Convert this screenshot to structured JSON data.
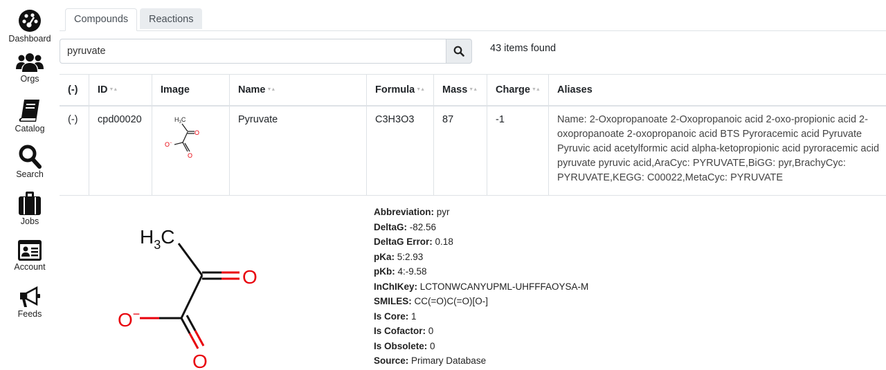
{
  "sidebar": {
    "items": [
      {
        "label": "Dashboard",
        "icon": "dashboard-icon"
      },
      {
        "label": "Orgs",
        "icon": "users-icon"
      },
      {
        "label": "Catalog",
        "icon": "book-icon"
      },
      {
        "label": "Search",
        "icon": "search-icon"
      },
      {
        "label": "Jobs",
        "icon": "briefcase-icon"
      },
      {
        "label": "Account",
        "icon": "id-card-icon"
      },
      {
        "label": "Feeds",
        "icon": "megaphone-icon"
      }
    ]
  },
  "tabs": [
    {
      "label": "Compounds",
      "active": true
    },
    {
      "label": "Reactions",
      "active": false
    }
  ],
  "search": {
    "value": "pyruvate",
    "icon": "search-icon",
    "results_text": "43 items found"
  },
  "table": {
    "columns": [
      "(-)",
      "ID",
      "Image",
      "Name",
      "Formula",
      "Mass",
      "Charge",
      "Aliases"
    ],
    "rows": [
      {
        "toggle": "(-)",
        "id": "cpd00020",
        "name": "Pyruvate",
        "formula": "C3H3O3",
        "mass": "87",
        "charge": "-1",
        "aliases": "Name: 2-Oxopropanoate 2-Oxopropanoic acid 2-oxo-propionic acid 2-oxopropanoate 2-oxopropanoic acid BTS Pyroracemic acid Pyruvate Pyruvic acid acetylformic acid alpha-ketopropionic acid pyroracemic acid pyruvate pyruvic acid,AraCyc: PYRUVATE,BiGG: pyr,BrachyCyc: PYRUVATE,KEGG: C00022,MetaCyc: PYRUVATE"
      }
    ]
  },
  "molecule": {
    "methyl": "H",
    "methyl_sub": "3",
    "methyl_c": "C",
    "oxygen": "O",
    "charge": "−",
    "atom_color": "#e8000b"
  },
  "details": [
    {
      "label": "Abbreviation:",
      "value": "pyr"
    },
    {
      "label": "DeltaG:",
      "value": "-82.56"
    },
    {
      "label": "DeltaG Error:",
      "value": "0.18"
    },
    {
      "label": "pKa:",
      "value": "5:2.93"
    },
    {
      "label": "pKb:",
      "value": "4:-9.58"
    },
    {
      "label": "InChIKey:",
      "value": "LCTONWCANYUPML-UHFFFAOYSA-M"
    },
    {
      "label": "SMILES:",
      "value": "CC(=O)C(=O)[O-]"
    },
    {
      "label": "Is Core:",
      "value": "1"
    },
    {
      "label": "Is Cofactor:",
      "value": "0"
    },
    {
      "label": "Is Obsolete:",
      "value": "0"
    },
    {
      "label": "Source:",
      "value": "Primary Database"
    }
  ]
}
